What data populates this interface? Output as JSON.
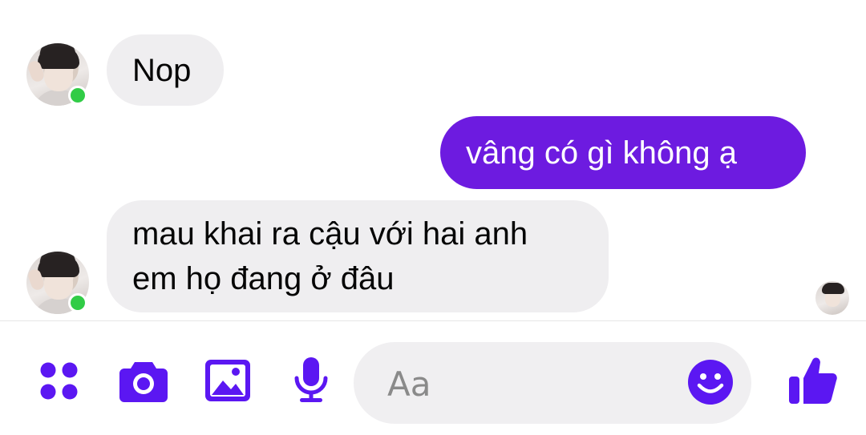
{
  "messages": [
    {
      "side": "incoming",
      "lines": [
        "Nop"
      ]
    },
    {
      "side": "outgoing",
      "lines": [
        "vâng có gì không ạ"
      ]
    },
    {
      "side": "incoming",
      "lines": [
        "mau khai ra cậu với hai anh",
        "em họ đang ở đâu"
      ]
    }
  ],
  "composer": {
    "placeholder": "Aa",
    "icons": [
      "apps-icon",
      "camera-icon",
      "gallery-icon",
      "microphone-icon",
      "emoji-icon",
      "thumbs-up-icon"
    ]
  },
  "colors": {
    "accent": "#5b17f2",
    "outgoing_bubble": "#6d1be0",
    "incoming_bubble": "#efeef0",
    "online": "#31cc46"
  }
}
